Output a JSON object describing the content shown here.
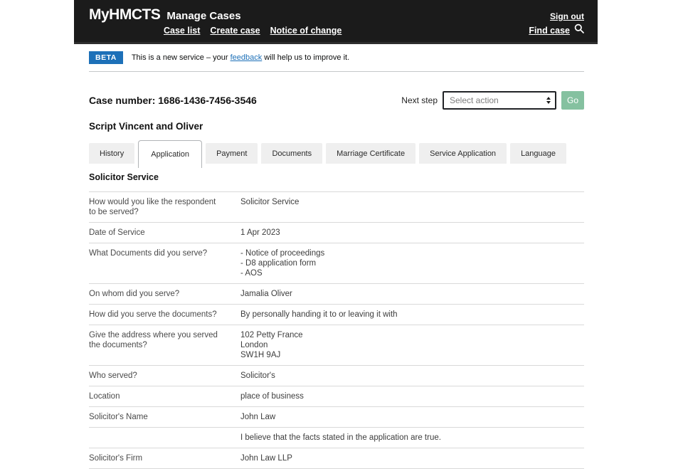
{
  "header": {
    "logo": "MyHMCTS",
    "app_title": "Manage Cases",
    "sign_out": "Sign out",
    "nav": [
      "Case list",
      "Create case",
      "Notice of change"
    ],
    "find_case": "Find case"
  },
  "beta": {
    "badge": "BETA",
    "text_before": "This is a new service – your ",
    "link": "feedback",
    "text_after": " will help us to improve it."
  },
  "case": {
    "number_label": "Case number: 1686-1436-7456-3546",
    "next_step_label": "Next step",
    "select_value": "Select action",
    "go_label": "Go",
    "title": "Script Vincent and Oliver"
  },
  "tabs": [
    {
      "label": "History",
      "active": false
    },
    {
      "label": "Application",
      "active": true
    },
    {
      "label": "Payment",
      "active": false
    },
    {
      "label": "Documents",
      "active": false
    },
    {
      "label": "Marriage Certificate",
      "active": false
    },
    {
      "label": "Service Application",
      "active": false
    },
    {
      "label": "Language",
      "active": false
    }
  ],
  "section": {
    "heading": "Solicitor Service",
    "rows": [
      {
        "question": "How would you like the respondent to be served?",
        "answer": "Solicitor Service"
      },
      {
        "question": "Date of Service",
        "answer": "1 Apr 2023"
      },
      {
        "question": "What Documents did you serve?",
        "answer": "- Notice of proceedings\n- D8 application form\n- AOS"
      },
      {
        "question": "On whom did you serve?",
        "answer": "Jamalia Oliver"
      },
      {
        "question": "How did you serve the documents?",
        "answer": "By personally handing it to or leaving it with"
      },
      {
        "question": "Give the address where you served the documents?",
        "answer": "102 Petty France\nLondon\nSW1H 9AJ"
      },
      {
        "question": "Who served?",
        "answer": "Solicitor's"
      },
      {
        "question": "Location",
        "answer": "place of business"
      },
      {
        "question": "Solicitor's Name",
        "answer": "John Law"
      },
      {
        "question": "",
        "answer": "I believe that the facts stated in the application are true."
      },
      {
        "question": "Solicitor's Firm",
        "answer": "John Law LLP"
      }
    ]
  },
  "colors": {
    "header_bg": "#1b1b1b",
    "beta_badge_blue": "#1d70b8",
    "link_blue": "#1d70b8",
    "go_button_green": "#85c1a0",
    "tab_inactive_bg": "#efefef",
    "row_border": "#d9d9d9"
  },
  "icons": {
    "search": "search-icon",
    "select_arrows": "select-arrows-icon"
  }
}
